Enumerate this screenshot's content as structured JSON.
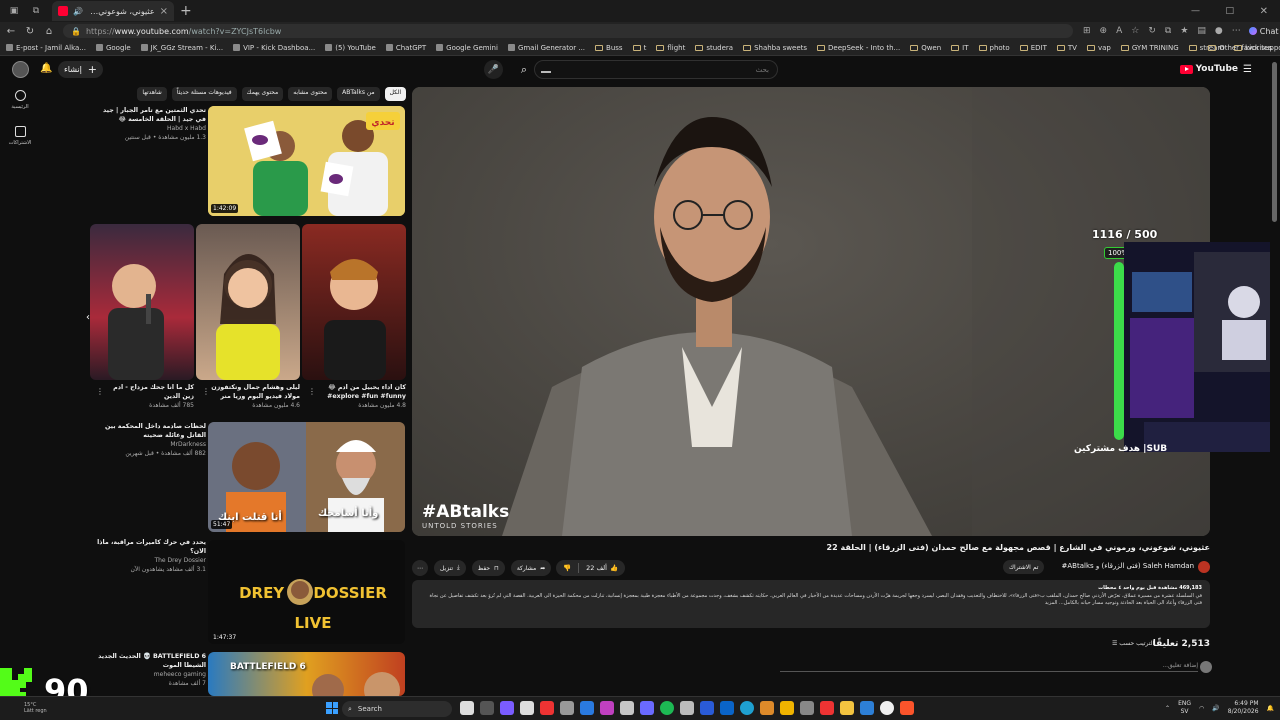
{
  "browser": {
    "tab_title": "عثيوني، شوعوني، ورموني في",
    "url_host": "www.youtube.com",
    "url_path": "/watch?v=ZYCJsT6lcbw",
    "chat_label": "Chat",
    "bookmarks": [
      "E-post - Jamil Alka...",
      "Google",
      "JK_GGz Stream - Ki...",
      "VIP - Kick Dashboa...",
      "(5) YouTube",
      "ChatGPT",
      "Google Gemini",
      "Gmail Generator ...",
      "Buss",
      "t",
      "flight",
      "studera",
      "Shahba sweets",
      "DeepSeek - Into th...",
      "Qwen",
      "IT",
      "photo",
      "EDIT",
      "TV",
      "vap",
      "GYM TRINING",
      "stream",
      "kick support",
      "joob"
    ],
    "other_favorites": "Other favorites"
  },
  "youtube": {
    "logo": "YouTube",
    "search_placeholder": "بحث",
    "create_label": "إنشاء",
    "mini_guide": [
      "الرئيسية",
      "الاشتراكات"
    ],
    "chips": [
      "الكل",
      "ABTalks من",
      "محتوى مشابه",
      "محتوى يهمك",
      "فيديوهات مستلة حديثاً",
      "شاهدتها"
    ]
  },
  "recommendations": [
    {
      "title": "تحدي الثمتين مع تامر الجبار | جيد في جيد | الحلقة الخامسة 😂",
      "channel": "Habd x Habd",
      "meta": "1.3 مليون مشاهدة • قبل سنتين",
      "duration": "1:42:09"
    },
    {
      "title": "كل ما انا جحك مزداح - ادم زين الدين",
      "channel": "",
      "meta": "785 ألف مشاهدة",
      "duration": ""
    },
    {
      "title": "ليلى وهشام جمال وتكتفوزن مولاد فيديو البوم وريا منر",
      "channel": "",
      "meta": "4.6 مليون مشاهدة",
      "duration": ""
    },
    {
      "title": "كان اداء يحبيل من ادم 😂 explore #fun #funny#",
      "channel": "",
      "meta": "4.8 مليون مشاهدة",
      "duration": ""
    },
    {
      "title": "لحظات صادمة داخل المحكمة بين القاتل وعائلة ضحيته",
      "channel": "MrDarkness",
      "meta": "882 ألف مشاهدة • قبل شهرين",
      "duration": "51:47",
      "thumb_text_1": "أنا قتلت ابنك",
      "thumb_text_2": "وأنا أسامحك"
    },
    {
      "title": "يحدد في حرك كاميرات مراقبة، ماذا الان؟",
      "channel": "The Drey Dossier",
      "meta": "3.1 ألف مشاهد يشاهدون الآن",
      "duration": "1:47:37",
      "thumb_text": "DREY DOSSIER LIVE"
    },
    {
      "title": "BATTLEFIELD 6 💀 الحديث الجديد الشيطا الموت",
      "channel": "meheeco gaming",
      "meta": "7 ألف مشاهدة",
      "duration": ""
    }
  ],
  "video": {
    "title": "عثيوني، شوعوني، ورموني في الشارع | قصص مجهولة مع صالح حمدان (فتى الزرقاء) | الحلقة 22",
    "watermark_main": "#ABtalks",
    "watermark_sub": "UNTOLD STORIES",
    "channel_name": "Saleh Hamdan (فتى الزرقاء) و ABtalks#",
    "subscribe_label": "تم الاشتراك",
    "likes": "22 ألف",
    "like_tooltip": "أعجبني هذا",
    "share_label": "مشاركة",
    "save_label": "حفظ",
    "download_label": "تنزيل",
    "clip_label": "مقطع",
    "description_stats": "469,183 مشاهدة قبل يوم واحد ٤ محطات",
    "description_text": "في السلسلة عشرة من مسيرة عملاق، تعرّض الأردني صالح حمدان، الملقب ب«فتى الزرقاء»، للاختطاف والتعذيب وفقدان البصر، ليسرد وجعها لجريمة هزّت الأردن ومساحات عديدة من الأخبار في العالم العربي. حكايته تكشف بشغف، وجدت مجموعة من الأطباء معجزة طبية بمعجزة إنسانية، تنازلت من محكمة الحيزة الى العربية. القصة التي لم تُروَ بعد تكشف تفاصيل عن نجاة فتى الزرقاء وأعاد الى الحياة بعد الحادثة وتوجيه مسار حياته بالكامل... المزيد",
    "comments_count": "2,513 تعليقًا",
    "sort_label": "الترتيب حسب",
    "add_comment_placeholder": "إضافة تعليق..."
  },
  "overlay": {
    "sub_counter": "1116 / 500",
    "progress_label": "100%",
    "progress_fraction": 1.0,
    "sub_goal": "SUB| هدف مشتركين",
    "kick_number": "90"
  },
  "taskbar": {
    "search_label": "Search",
    "weather_top": "15°C",
    "weather_bottom": "Lätt regn",
    "language_top": "ENG",
    "language_bottom": "SV",
    "time": "6:49 PM",
    "date": "8/20/2026"
  },
  "colors": {
    "accent_red": "#ff0033",
    "progress_green": "#3cdc4a",
    "kick_green": "#53fc18",
    "background": "#0f0f0f"
  }
}
